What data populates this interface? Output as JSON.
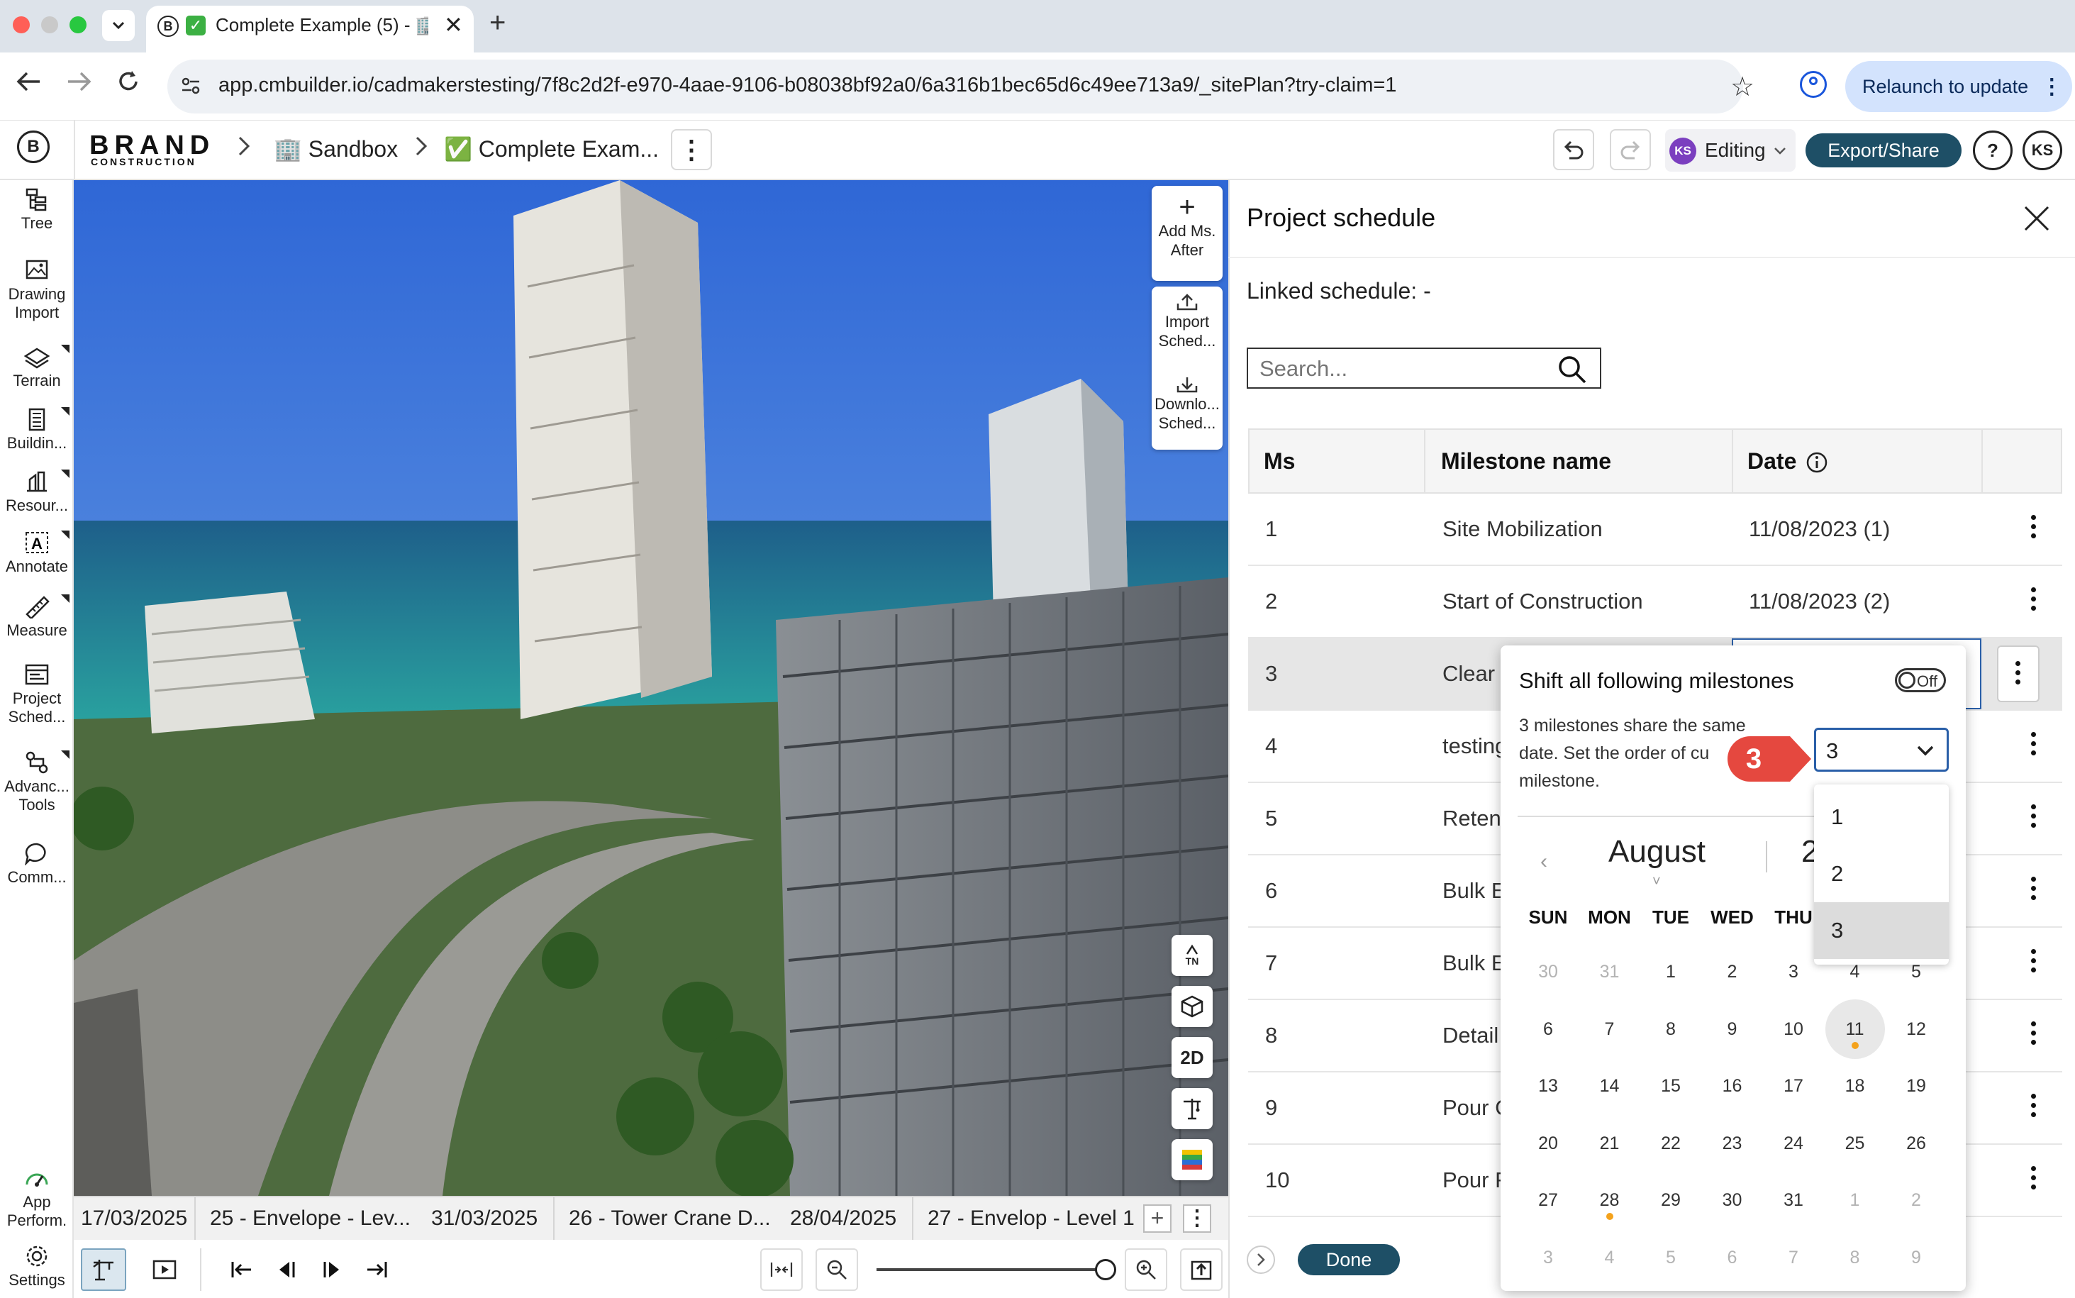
{
  "browser": {
    "tab_title": "Complete Example (5) - 🏢",
    "url": "app.cmbuilder.io/cadmakerstesting/7f8c2d2f-e970-4aae-9106-b08038bf92a0/6a316b1bec65d6c49ee713a9/_sitePlan?try-claim=1",
    "relaunch_label": "Relaunch to update"
  },
  "header": {
    "brand": "BRAND",
    "brand_sub": "CONSTRUCTION",
    "breadcrumb_1": "🏢 Sandbox",
    "breadcrumb_2": "✅ Complete Exam...",
    "user_initials": "KS",
    "mode_label": "Editing",
    "export_label": "Export/Share",
    "help_label": "?"
  },
  "left_toolbar": [
    {
      "label": "Tree",
      "icon": "tree-icon"
    },
    {
      "label": "Drawing\nImport",
      "icon": "drawing-import-icon"
    },
    {
      "label": "Terrain",
      "icon": "terrain-icon"
    },
    {
      "label": "Buildin...",
      "icon": "building-icon"
    },
    {
      "label": "Resour...",
      "icon": "resources-icon"
    },
    {
      "label": "Annotate",
      "icon": "annotate-icon"
    },
    {
      "label": "Measure",
      "icon": "measure-icon"
    },
    {
      "label": "Project\nSched...",
      "icon": "project-schedule-icon"
    },
    {
      "label": "Advanc...\nTools",
      "icon": "advanced-tools-icon"
    },
    {
      "label": "Comm...",
      "icon": "comments-icon"
    }
  ],
  "left_toolbar_bottom": [
    {
      "label": "App\nPerform.",
      "icon": "app-performance-icon"
    },
    {
      "label": "Settings",
      "icon": "settings-icon"
    }
  ],
  "viewport_tools": {
    "add_ms_after": "Add Ms.\nAfter",
    "import_schedule": "Import\nSched...",
    "download_schedule": "Downlo...\nSched...",
    "north_label": "TN",
    "view_2d": "2D"
  },
  "timeline": {
    "items": [
      "17/03/2025",
      "25 - Envelope - Lev...",
      "31/03/2025",
      "26 - Tower Crane D...",
      "28/04/2025",
      "27 - Envelop - Level 1"
    ],
    "zoom_level": 0.98
  },
  "panel": {
    "title": "Project schedule",
    "linked_schedule": "Linked schedule: -",
    "search_placeholder": "Search...",
    "columns": {
      "ms": "Ms",
      "name": "Milestone name",
      "date": "Date"
    },
    "rows": [
      {
        "ms": "1",
        "name": "Site Mobilization",
        "date": "11/08/2023 (1)"
      },
      {
        "ms": "2",
        "name": "Start of Construction",
        "date": "11/08/2023 (2)"
      },
      {
        "ms": "3",
        "name": "Clear",
        "date": ""
      },
      {
        "ms": "4",
        "name": "testing",
        "date": ""
      },
      {
        "ms": "5",
        "name": "Reten",
        "date": ""
      },
      {
        "ms": "6",
        "name": "Bulk E",
        "date": ""
      },
      {
        "ms": "7",
        "name": "Bulk E",
        "date": ""
      },
      {
        "ms": "8",
        "name": "Detail",
        "date": ""
      },
      {
        "ms": "9",
        "name": "Pour C",
        "date": ""
      },
      {
        "ms": "10",
        "name": "Pour F",
        "date": ""
      }
    ],
    "done_label": "Done"
  },
  "popover": {
    "shift_label": "Shift all following milestones",
    "toggle_label": "Off",
    "order_text_1": "3 milestones share the same",
    "order_text_2": "date. Set the order of cu",
    "order_text_3": "milestone.",
    "order_selected": "3",
    "order_options": [
      "1",
      "2",
      "3"
    ],
    "step_badge": "3",
    "calendar": {
      "month": "August",
      "year_partial": "2",
      "weekdays": [
        "SUN",
        "MON",
        "TUE",
        "WED",
        "THU",
        "",
        ""
      ],
      "weeks": [
        [
          "30",
          "31",
          "1",
          "2",
          "3",
          "4",
          "5"
        ],
        [
          "6",
          "7",
          "8",
          "9",
          "10",
          "11",
          "12"
        ],
        [
          "13",
          "14",
          "15",
          "16",
          "17",
          "18",
          "19"
        ],
        [
          "20",
          "21",
          "22",
          "23",
          "24",
          "25",
          "26"
        ],
        [
          "27",
          "28",
          "29",
          "30",
          "31",
          "1",
          "2"
        ],
        [
          "3",
          "4",
          "5",
          "6",
          "7",
          "8",
          "9"
        ]
      ],
      "selected_day": "11"
    }
  },
  "colors": {
    "accent": "#1e4f66",
    "marker": "#e07b35",
    "event_dot": "#f4a21c",
    "avatar": "#7b3fbf"
  }
}
